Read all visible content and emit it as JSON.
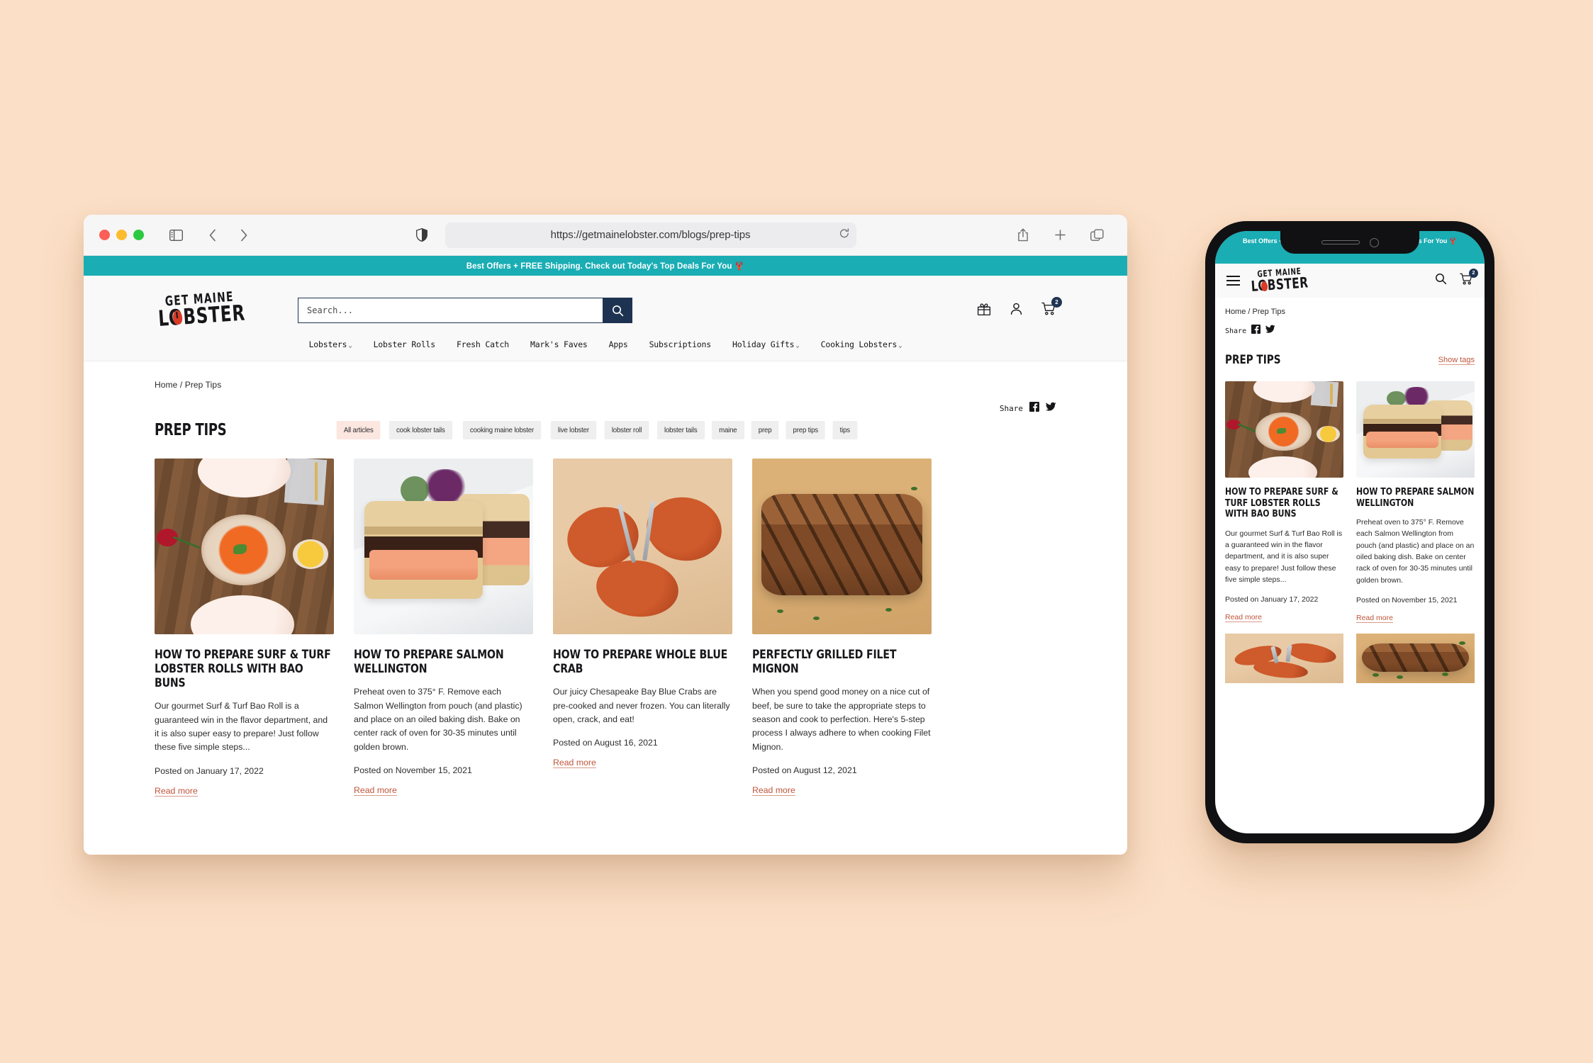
{
  "browser": {
    "url": "https://getmainelobster.com/blogs/prep-tips",
    "icons": {
      "sidebar": "sidebar-toggle-icon",
      "back": "back-arrow-icon",
      "forward": "forward-arrow-icon",
      "shield": "privacy-shield-icon",
      "reload": "reload-icon",
      "share": "share-icon",
      "newtab": "new-tab-icon",
      "tabs": "tab-overview-icon"
    }
  },
  "announcement": {
    "text": "Best Offers + FREE Shipping. Check out Today's Top Deals For You 🦞",
    "bg_color": "#1aadb4"
  },
  "header": {
    "logo_line1": "GET MAINE",
    "logo_line2": "LOBSTER",
    "search_placeholder": "Search...",
    "search_value": "",
    "cart_count": "2",
    "accent_navy": "#1e3352"
  },
  "nav": {
    "items": [
      {
        "label": "Lobsters",
        "caret": true
      },
      {
        "label": "Lobster Rolls",
        "caret": false
      },
      {
        "label": "Fresh Catch",
        "caret": false
      },
      {
        "label": "Mark's Faves",
        "caret": false
      },
      {
        "label": "Apps",
        "caret": false
      },
      {
        "label": "Subscriptions",
        "caret": false
      },
      {
        "label": "Holiday Gifts",
        "caret": true
      },
      {
        "label": "Cooking Lobsters",
        "caret": true
      }
    ]
  },
  "page": {
    "breadcrumb": "Home / Prep Tips",
    "share_label": "Share",
    "title": "PREP TIPS",
    "tags": [
      {
        "label": "All articles",
        "active": true
      },
      {
        "label": "cook lobster tails",
        "active": false
      },
      {
        "label": "cooking maine lobster",
        "active": false
      },
      {
        "label": "live lobster",
        "active": false
      },
      {
        "label": "lobster roll",
        "active": false
      },
      {
        "label": "lobster tails",
        "active": false
      },
      {
        "label": "maine",
        "active": false
      },
      {
        "label": "prep",
        "active": false
      },
      {
        "label": "prep tips",
        "active": false
      },
      {
        "label": "tips",
        "active": false
      }
    ],
    "read_more_label": "Read more",
    "link_color": "#c0553b",
    "articles": [
      {
        "title": "HOW TO PREPARE SURF & TURF LOBSTER ROLLS WITH BAO BUNS",
        "excerpt": "Our gourmet Surf & Turf Bao Roll is a guaranteed win in the flavor department, and it is also super easy to prepare! Just follow these five simple steps...",
        "posted": "Posted on January 17, 2022",
        "image": "surf-turf-lobster-rolls-photo"
      },
      {
        "title": "HOW TO PREPARE SALMON WELLINGTON",
        "excerpt": "Preheat oven to 375° F. Remove each Salmon Wellington from pouch (and plastic) and place on an oiled baking dish. Bake on center rack of oven for 30-35 minutes until golden brown.",
        "posted": "Posted on November 15, 2021",
        "image": "salmon-wellington-photo"
      },
      {
        "title": "HOW TO PREPARE WHOLE BLUE CRAB",
        "excerpt": "Our juicy Chesapeake Bay Blue Crabs are pre-cooked and never frozen. You can literally open, crack, and eat!",
        "posted": "Posted on August 16, 2021",
        "image": "blue-crab-photo"
      },
      {
        "title": "PERFECTLY GRILLED FILET MIGNON",
        "excerpt": "When you spend good money on a nice cut of beef, be sure to take the appropriate steps to season and cook to perfection. Here's 5-step process I always adhere to when cooking Filet Mignon.",
        "posted": "Posted on August 12, 2021",
        "image": "filet-mignon-photo"
      }
    ]
  },
  "mobile": {
    "announcement": "Best Offers + FREE Shipping. Check out Today's Top Deals For You 🦞",
    "logo_line1": "GET MAINE",
    "logo_line2": "LOBSTER",
    "cart_count": "2",
    "breadcrumb": "Home / Prep Tips",
    "share_label": "Share",
    "title": "PREP TIPS",
    "show_tags_label": "Show tags",
    "read_more_label": "Read more",
    "articles": [
      {
        "title": "HOW TO PREPARE SURF & TURF LOBSTER ROLLS WITH BAO BUNS",
        "excerpt": "Our gourmet Surf & Turf Bao Roll is a guaranteed win in the flavor department, and it is also super easy to prepare! Just follow these five simple steps...",
        "posted": "Posted on January 17, 2022",
        "image": "surf-turf-lobster-rolls-photo"
      },
      {
        "title": "HOW TO PREPARE SALMON WELLINGTON",
        "excerpt": "Preheat oven to 375° F. Remove each Salmon Wellington from pouch (and plastic) and place on an oiled baking dish. Bake on center rack of oven for 30-35 minutes until golden brown.",
        "posted": "Posted on November 15, 2021",
        "image": "salmon-wellington-photo"
      }
    ]
  }
}
